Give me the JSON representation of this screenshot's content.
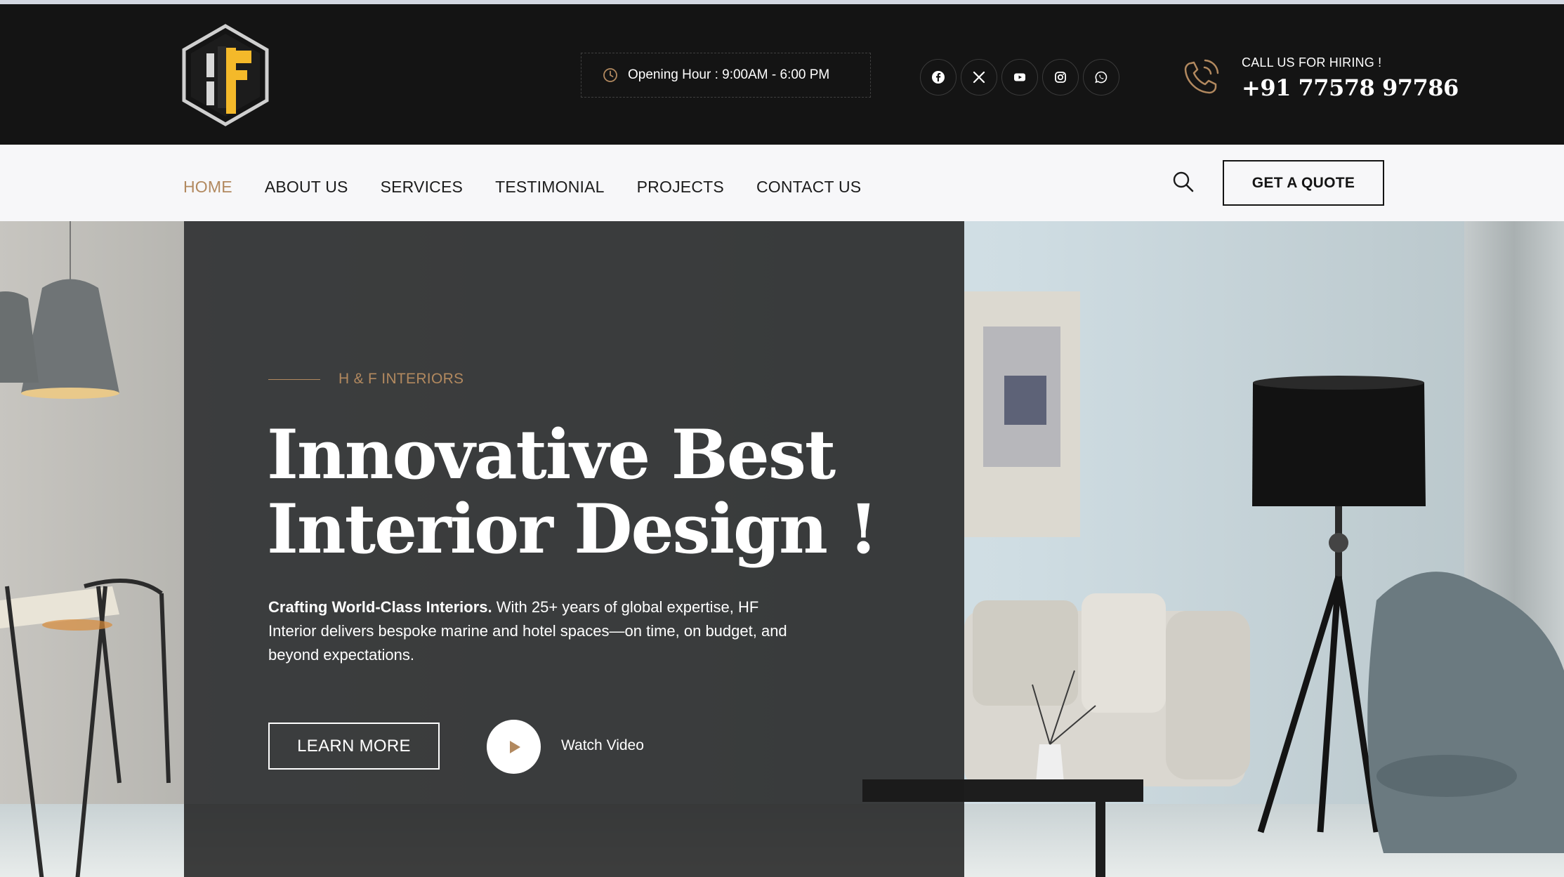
{
  "brand": {
    "logo_letters": "HF",
    "accent": "#f4b92a"
  },
  "topbar": {
    "hours_text": "Opening Hour : 9:00AM - 6:00 PM",
    "socials": [
      "facebook-icon",
      "x-icon",
      "youtube-icon",
      "instagram-icon",
      "whatsapp-icon"
    ],
    "call_label": "CALL US FOR HIRING !",
    "call_number": "+91 77578 97786"
  },
  "nav": {
    "items": [
      "HOME",
      "ABOUT US",
      "SERVICES",
      "TESTIMONIAL",
      "PROJECTS",
      "CONTACT US"
    ],
    "active": "HOME",
    "quote_label": "GET A QUOTE"
  },
  "hero": {
    "eyebrow": "H & F INTERIORS",
    "title_line1": "Innovative Best",
    "title_line2": "Interior Design !",
    "desc_bold": "Crafting World-Class Interiors.",
    "desc_rest": " With 25+ years of global expertise, HF Interior delivers bespoke marine and hotel spaces—on time, on budget, and beyond expectations.",
    "learn_label": "LEARN MORE",
    "video_label": "Watch Video"
  },
  "colors": {
    "accent": "#b2895f",
    "dark": "#141414",
    "nav_bg": "#f7f7f9"
  }
}
